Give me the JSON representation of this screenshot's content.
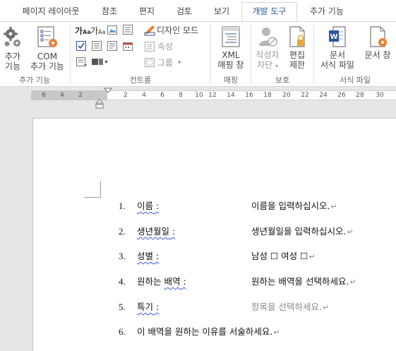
{
  "tabs": [
    {
      "label": "페이지 레이아웃",
      "active": false
    },
    {
      "label": "참조",
      "active": false
    },
    {
      "label": "편지",
      "active": false
    },
    {
      "label": "검토",
      "active": false
    },
    {
      "label": "보기",
      "active": false
    },
    {
      "label": "개발 도구",
      "active": true
    },
    {
      "label": "추가 기능",
      "active": false
    }
  ],
  "ribbon": {
    "addins": {
      "btn_addin_1": "추가",
      "btn_addin_2": "기능",
      "btn_com_1": "COM",
      "btn_com_2": "추가 기능",
      "group_label": "추가 기능"
    },
    "controls": {
      "design_mode": "디자인 모드",
      "properties": "속성",
      "group": "그룹",
      "group_label": "컨트롤"
    },
    "mapping": {
      "xml_1": "XML",
      "xml_2": "매핑 창",
      "group_label": "매핑"
    },
    "protect": {
      "block_authors_1": "작성자",
      "block_authors_2": "차단",
      "restrict_1": "편집",
      "restrict_2": "제한",
      "group_label": "보호"
    },
    "templates": {
      "template_1": "문서",
      "template_2": "서식 파일",
      "panel": "문서 창",
      "group_label": "서식 파일"
    }
  },
  "ruler": {
    "numbers": [
      "6",
      "4",
      "2",
      "2",
      "4",
      "6",
      "8",
      "10",
      "12",
      "14",
      "16",
      "18",
      "20",
      "22",
      "24",
      "26",
      "28",
      "30"
    ]
  },
  "document": {
    "items": [
      {
        "num": "1.",
        "label_main": "이름",
        "label_suffix": " :",
        "value": "이름을 입력하십시오.",
        "mark": "↵",
        "placeholder": false
      },
      {
        "num": "2.",
        "label_main": "생년월일",
        "label_suffix": " :",
        "value": "생년월일을 입력하십시오.",
        "mark": "↵",
        "placeholder": false
      },
      {
        "num": "3.",
        "label_main": "성별",
        "label_suffix": " :",
        "value": "남성 ☐ 여성 ☐",
        "mark": "↵",
        "placeholder": false
      },
      {
        "num": "4.",
        "label_pre": "원하는 ",
        "label_main": "배역",
        "label_suffix": " :",
        "value": "원하는 배역을 선택하세요.",
        "mark": "↵",
        "placeholder": false
      },
      {
        "num": "5.",
        "label_main": "특기",
        "label_suffix": " :",
        "value": "항목을 선택하세요.",
        "mark": "↵",
        "placeholder": true
      },
      {
        "num": "6.",
        "label_main": "",
        "label_pre": "이 배역을 원하는 이유를 서술하세요.",
        "label_suffix": "",
        "value": "",
        "mark": "↵",
        "placeholder": false
      }
    ]
  },
  "colors": {
    "accent": "#2b579a",
    "gear_orange": "#e8833a",
    "word_blue": "#2b579a",
    "spell_wavy": "#3b5bd9"
  }
}
